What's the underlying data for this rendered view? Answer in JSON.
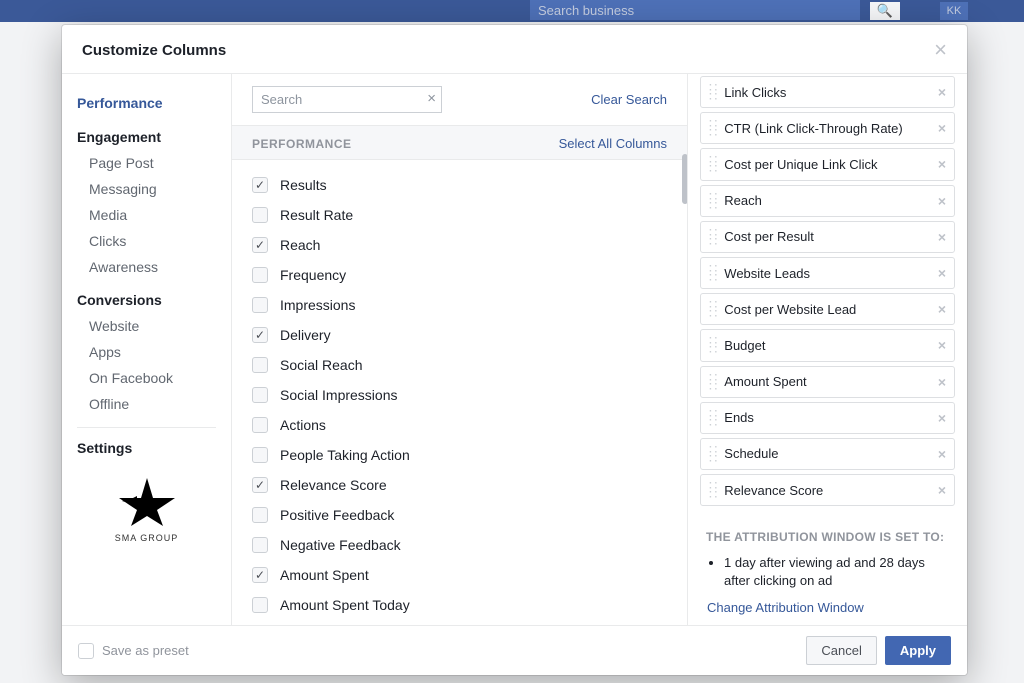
{
  "topbar": {
    "search_placeholder": "Search business",
    "badge": "KK"
  },
  "modal": {
    "title": "Customize Columns"
  },
  "sidebar": {
    "performance": "Performance",
    "engagement_header": "Engagement",
    "engagement": [
      "Page Post",
      "Messaging",
      "Media",
      "Clicks",
      "Awareness"
    ],
    "conversions_header": "Conversions",
    "conversions": [
      "Website",
      "Apps",
      "On Facebook",
      "Offline"
    ],
    "settings_header": "Settings",
    "logo_text": "SMA GROUP"
  },
  "center": {
    "search_placeholder": "Search",
    "clear_search": "Clear Search",
    "section_title": "PERFORMANCE",
    "select_all": "Select All Columns",
    "items": [
      {
        "label": "Results",
        "checked": true
      },
      {
        "label": "Result Rate",
        "checked": false
      },
      {
        "label": "Reach",
        "checked": true
      },
      {
        "label": "Frequency",
        "checked": false
      },
      {
        "label": "Impressions",
        "checked": false
      },
      {
        "label": "Delivery",
        "checked": true
      },
      {
        "label": "Social Reach",
        "checked": false
      },
      {
        "label": "Social Impressions",
        "checked": false
      },
      {
        "label": "Actions",
        "checked": false
      },
      {
        "label": "People Taking Action",
        "checked": false
      },
      {
        "label": "Relevance Score",
        "checked": true
      },
      {
        "label": "Positive Feedback",
        "checked": false
      },
      {
        "label": "Negative Feedback",
        "checked": false
      },
      {
        "label": "Amount Spent",
        "checked": true
      },
      {
        "label": "Amount Spent Today",
        "checked": false
      }
    ]
  },
  "selected": [
    "Link Clicks",
    "CTR (Link Click-Through Rate)",
    "Cost per Unique Link Click",
    "Reach",
    "Cost per Result",
    "Website Leads",
    "Cost per Website Lead",
    "Budget",
    "Amount Spent",
    "Ends",
    "Schedule",
    "Relevance Score"
  ],
  "attribution": {
    "title": "THE ATTRIBUTION WINDOW IS SET TO:",
    "text": "1 day after viewing ad and 28 days after clicking on ad",
    "link": "Change Attribution Window"
  },
  "footer": {
    "save_preset": "Save as preset",
    "cancel": "Cancel",
    "apply": "Apply"
  }
}
